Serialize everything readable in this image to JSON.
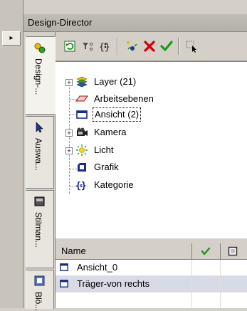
{
  "panel": {
    "title": "Design-Director"
  },
  "vertical_tabs": [
    {
      "label": "Design-...",
      "icon": "design-director-icon",
      "active": true
    },
    {
      "label": "Auswa...",
      "icon": "cursor-select-icon",
      "active": false
    },
    {
      "label": "Stilman...",
      "icon": "style-manager-icon",
      "active": false
    },
    {
      "label": "Blö...",
      "icon": "block-icon",
      "active": false
    }
  ],
  "toolbar": {
    "buttons": [
      {
        "name": "refresh-icon"
      },
      {
        "name": "filter-icon"
      },
      {
        "name": "braces-icon"
      },
      {
        "name": "new-element-icon"
      },
      {
        "name": "delete-icon"
      },
      {
        "name": "apply-check-icon"
      },
      {
        "name": "pick-icon"
      }
    ]
  },
  "tree": [
    {
      "label": "Layer (21)",
      "icon": "layer-icon",
      "expandable": true,
      "expander": "+",
      "selected": false
    },
    {
      "label": "Arbeitsebenen",
      "icon": "workplane-icon",
      "expandable": false,
      "selected": false
    },
    {
      "label": "Ansicht (2)",
      "icon": "view-icon",
      "expandable": false,
      "selected": true
    },
    {
      "label": "Kamera",
      "icon": "camera-icon",
      "expandable": true,
      "expander": "+",
      "selected": false
    },
    {
      "label": "Licht",
      "icon": "light-icon",
      "expandable": true,
      "expander": "+",
      "selected": false
    },
    {
      "label": "Grafik",
      "icon": "graphic-icon",
      "expandable": false,
      "selected": false
    },
    {
      "label": "Kategorie",
      "icon": "category-icon",
      "expandable": false,
      "selected": false
    }
  ],
  "grid": {
    "columns": [
      {
        "label": "Name"
      },
      {
        "label": "",
        "icon": "check-column-icon"
      },
      {
        "label": "",
        "icon": "box-column-icon"
      }
    ],
    "rows": [
      {
        "name": "Ansicht_0",
        "selected": false
      },
      {
        "name": "Träger-von rechts",
        "selected": true
      }
    ]
  },
  "colors": {
    "background": "#d4d0c8",
    "selection_row": "#d8dbe6",
    "delete_red": "#d00000",
    "check_green": "#1a9a1a"
  }
}
